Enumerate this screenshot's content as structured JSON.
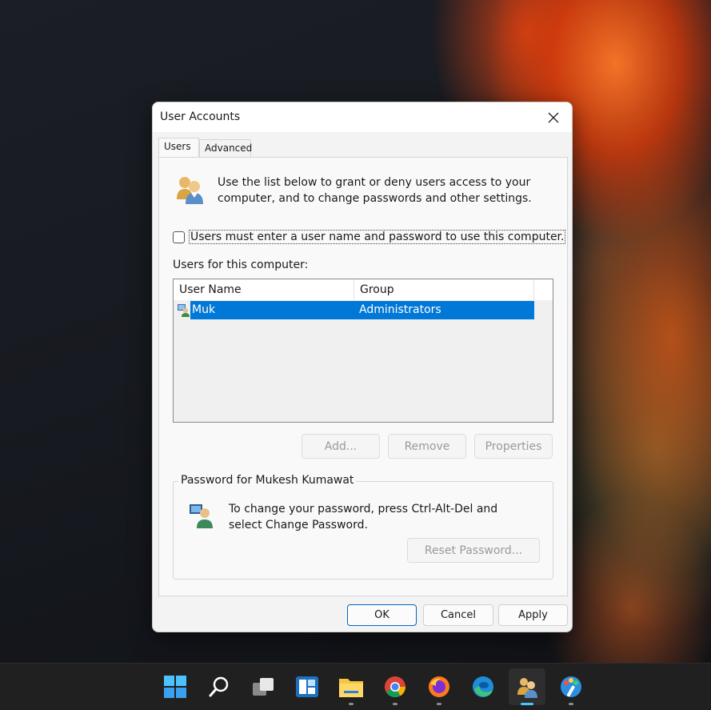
{
  "dialog": {
    "title": "User Accounts",
    "tabs": [
      {
        "label": "Users",
        "active": true
      },
      {
        "label": "Advanced",
        "active": false
      }
    ],
    "intro_text": "Use the list below to grant or deny users access to your computer, and to change passwords and other settings.",
    "checkbox": {
      "label": "Users must enter a user name and password to use this computer.",
      "checked": false
    },
    "users_label": "Users for this computer:",
    "list": {
      "columns": [
        "User Name",
        "Group"
      ],
      "rows": [
        {
          "user": "Muk",
          "group": "Administrators",
          "selected": true
        }
      ]
    },
    "buttons": {
      "add": "Add...",
      "remove": "Remove",
      "properties": "Properties"
    },
    "password_group": {
      "title": "Password for Mukesh Kumawat",
      "text": "To change your password, press Ctrl-Alt-Del and select Change Password.",
      "reset_button": "Reset Password..."
    },
    "footer": {
      "ok": "OK",
      "cancel": "Cancel",
      "apply": "Apply"
    }
  },
  "taskbar": {
    "items": [
      {
        "icon": "windows-start-icon"
      },
      {
        "icon": "search-icon"
      },
      {
        "icon": "task-view-icon"
      },
      {
        "icon": "widgets-icon"
      },
      {
        "icon": "file-explorer-icon"
      },
      {
        "icon": "chrome-icon"
      },
      {
        "icon": "firefox-icon"
      },
      {
        "icon": "edge-icon"
      },
      {
        "icon": "user-accounts-icon",
        "active": true
      },
      {
        "icon": "paint-icon"
      }
    ]
  },
  "colors": {
    "selection": "#0078d7",
    "ok_border": "#0067c0",
    "taskbar": "#202020"
  }
}
